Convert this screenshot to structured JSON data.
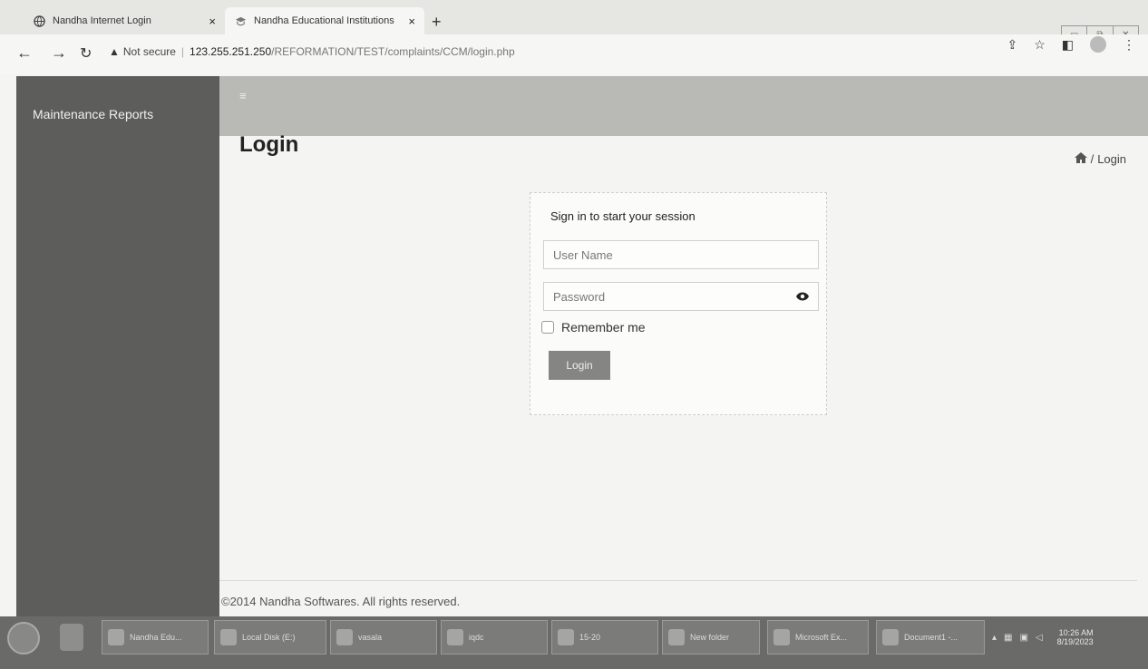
{
  "browser": {
    "tabs": [
      {
        "title": "Nandha Internet Login",
        "active": false
      },
      {
        "title": "Nandha Educational Institutions",
        "active": true
      }
    ],
    "new_tab": "+",
    "close_glyph": "×",
    "security_label": "Not secure",
    "url_host": "123.255.251.250",
    "url_path": "/REFORMATION/TEST/complaints/CCM/login.php"
  },
  "sidebar": {
    "brand": "Maintenance Reports"
  },
  "topbar": {
    "menu_glyph": "≡"
  },
  "page": {
    "title": "Login",
    "breadcrumb_sep": "/",
    "breadcrumb_current": "Login"
  },
  "login": {
    "message": "Sign in to start your session",
    "username_placeholder": "User Name",
    "password_placeholder": "Password",
    "remember_label": "Remember me",
    "button_label": "Login"
  },
  "footer": {
    "text": "©2014 Nandha Softwares. All rights reserved."
  },
  "taskbar": {
    "tasks": [
      "Nandha Edu...",
      "Local Disk (E:)",
      "vasala",
      "iqdc",
      "15-20",
      "New folder",
      "Microsoft Ex...",
      "Document1 -..."
    ],
    "clock_time": "10:26 AM",
    "clock_date": "8/19/2023"
  },
  "colors": {
    "sidebar": "#5d5d5b",
    "topbar": "#b9b9b6",
    "login_button": "#858583"
  },
  "icons": [
    "globe-icon",
    "school-icon",
    "back-arrow-icon",
    "forward-arrow-icon",
    "reload-icon",
    "warning-icon",
    "share-icon",
    "star-icon",
    "side-panel-icon",
    "profile-icon",
    "kebab-menu-icon",
    "home-icon",
    "eye-icon"
  ]
}
